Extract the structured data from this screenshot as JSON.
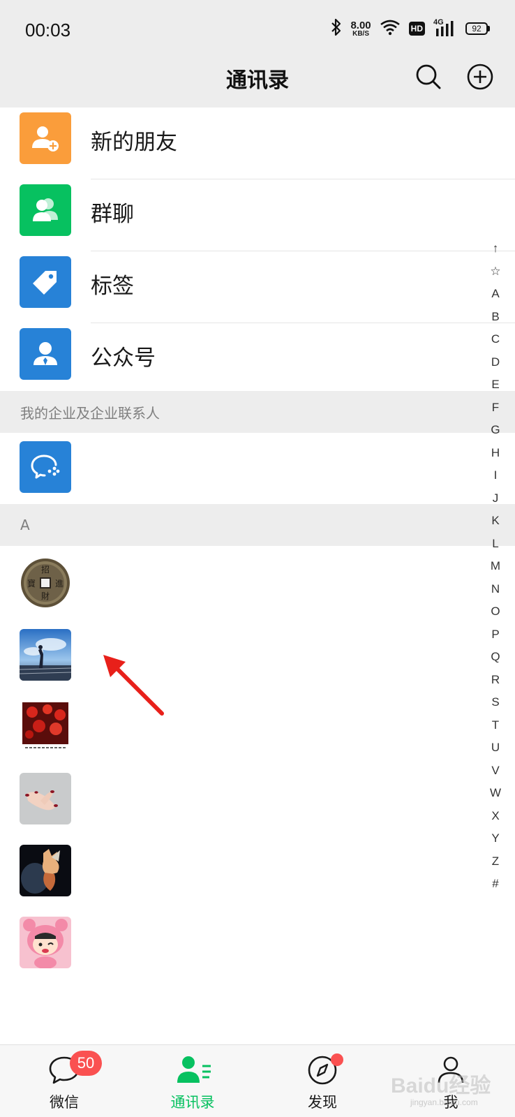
{
  "status_bar": {
    "time": "00:03",
    "net_speed_value": "8.00",
    "net_speed_unit": "KB/S",
    "hd_label": "HD",
    "network_type": "4G",
    "battery": "92",
    "icons": [
      "bluetooth-icon",
      "wifi-icon",
      "hd-icon",
      "signal-icon",
      "battery-icon"
    ]
  },
  "header": {
    "title": "通讯录",
    "icons": [
      "search-icon",
      "add-icon"
    ]
  },
  "menu": [
    {
      "label": "新的朋友",
      "icon": "add-friend-icon",
      "color": "#fa9d3b"
    },
    {
      "label": "群聊",
      "icon": "group-chat-icon",
      "color": "#07c160"
    },
    {
      "label": "标签",
      "icon": "tag-icon",
      "color": "#2782d7"
    },
    {
      "label": "公众号",
      "icon": "official-account-icon",
      "color": "#2782d7"
    }
  ],
  "sections": {
    "enterprise": "我的企业及企业联系人",
    "letter_a": "A"
  },
  "enterprise_item": {
    "icon": "wecom-icon",
    "color": "#2782d7"
  },
  "contacts": [
    {
      "avatar": "coin-avatar"
    },
    {
      "avatar": "sky-photo-avatar"
    },
    {
      "avatar": "red-lanterns-avatar"
    },
    {
      "avatar": "hand-nails-avatar"
    },
    {
      "avatar": "game-character-avatar"
    },
    {
      "avatar": "cartoon-avatar"
    }
  ],
  "index_letters": [
    "↑",
    "☆",
    "A",
    "B",
    "C",
    "D",
    "E",
    "F",
    "G",
    "H",
    "I",
    "J",
    "K",
    "L",
    "M",
    "N",
    "O",
    "P",
    "Q",
    "R",
    "S",
    "T",
    "U",
    "V",
    "W",
    "X",
    "Y",
    "Z",
    "#"
  ],
  "tabs": [
    {
      "label": "微信",
      "icon": "chat-bubble-icon",
      "badge": "50",
      "active": false
    },
    {
      "label": "通讯录",
      "icon": "contacts-icon",
      "active": true
    },
    {
      "label": "发现",
      "icon": "compass-icon",
      "active": false
    },
    {
      "label": "我",
      "icon": "person-icon",
      "active": false
    }
  ],
  "watermark": {
    "text": "Baidu经验",
    "sub": "jingyan.baidu.com"
  },
  "colors": {
    "accent": "#07c160",
    "badge": "#fa5151",
    "annotation": "#e8201a"
  }
}
